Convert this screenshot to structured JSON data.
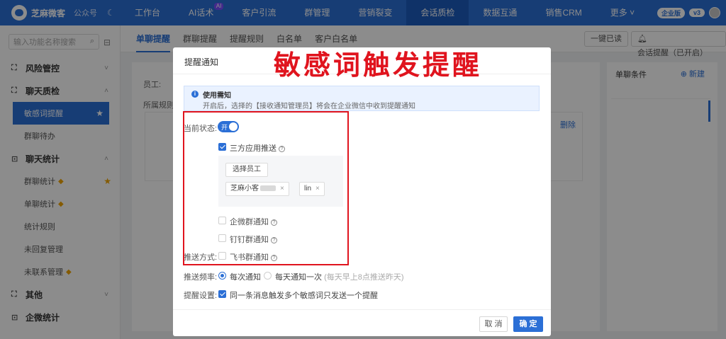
{
  "topbar": {
    "brand_name": "芝麻微客",
    "gzh_label": "公众号",
    "nav": [
      {
        "label": "工作台"
      },
      {
        "label": "AI话术",
        "badge": "AI"
      },
      {
        "label": "客户引流"
      },
      {
        "label": "群管理"
      },
      {
        "label": "营销裂变"
      },
      {
        "label": "会话质检",
        "active": true
      },
      {
        "label": "数据互通"
      },
      {
        "label": "销售CRM"
      },
      {
        "label": "更多"
      }
    ],
    "right_pill": "企业版",
    "right_version": "v3"
  },
  "sidebar": {
    "search_placeholder": "输入功能名称搜索",
    "groups": [
      {
        "label": "风险管控",
        "chevron": "˅"
      },
      {
        "label": "聊天质检",
        "chevron": "˄"
      },
      {
        "label": "聊天统计",
        "chevron": "˄"
      },
      {
        "label": "其他",
        "chevron": "˅"
      },
      {
        "label": "企微统计",
        "chevron": ""
      }
    ],
    "items": {
      "sensitive": "敏感词提醒",
      "group_pending": "群聊待办",
      "group_stats": "群聊统计",
      "single_stats": "单聊统计",
      "stat_rules": "统计规则",
      "unreplied": "未回复管理",
      "unlinked": "未联系管理"
    }
  },
  "subnav": {
    "tabs": [
      "单聊提醒",
      "群聊提醒",
      "提醒规则",
      "白名单",
      "客户白名单"
    ],
    "mark_read": "一键已读",
    "session_remind": "会话提醒（已开启）"
  },
  "background": {
    "employee_label": "员工:",
    "rule_label": "所属规则:",
    "delete_link": "删除",
    "right_title": "单聊条件",
    "right_new": "新建"
  },
  "modal": {
    "title": "提醒通知",
    "notice_title": "使用需知",
    "notice_desc": "开启后，选择的【接收通知管理员】将会在企业微信中收到提醒通知",
    "status_label": "当前状态:",
    "switch_text": "开",
    "third_party": "三方应用推送",
    "select_employee": "选择员工",
    "tags": [
      {
        "label": "芝麻小客"
      },
      {
        "label": "lin"
      }
    ],
    "wecom_group": "企微群通知",
    "dingtalk_group": "钉钉群通知",
    "push_method_label": "推送方式:",
    "feishu_group": "飞书群通知",
    "freq_label": "推送频率:",
    "freq_each": "每次通知",
    "freq_daily": "每天通知一次",
    "freq_daily_hint": "(每天早上8点推送昨天)",
    "setting_label": "提醒设置:",
    "setting_text": "同一条消息触发多个敏感词只发送一个提醒",
    "cancel": "取 消",
    "ok": "确 定"
  },
  "annotation": "敏感词触发提醒",
  "colors": {
    "brand_blue": "#2b6fd6",
    "highlight_red": "#e0141e"
  }
}
